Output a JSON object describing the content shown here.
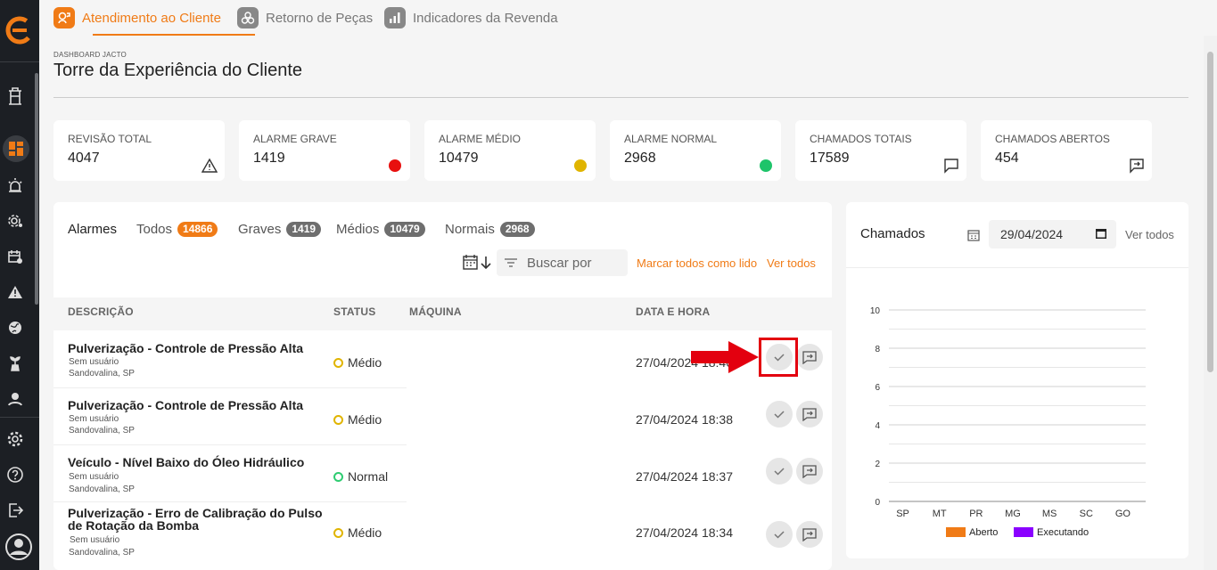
{
  "tabs": [
    {
      "label": "Atendimento ao Cliente",
      "active": true
    },
    {
      "label": "Retorno de Peças",
      "active": false
    },
    {
      "label": "Indicadores da Revenda",
      "active": false
    }
  ],
  "header": {
    "overline": "DASHBOARD JACTO",
    "title": "Torre da Experiência do Cliente"
  },
  "kpis": [
    {
      "label": "REVISÃO TOTAL",
      "value": "4047",
      "icon": "warning-icon"
    },
    {
      "label": "ALARME GRAVE",
      "value": "1419",
      "dot": "#e8100f"
    },
    {
      "label": "ALARME MÉDIO",
      "value": "10479",
      "dot": "#e0b400"
    },
    {
      "label": "ALARME NORMAL",
      "value": "2968",
      "dot": "#1ec46a"
    },
    {
      "label": "CHAMADOS TOTAIS",
      "value": "17589",
      "icon": "chat-icon"
    },
    {
      "label": "CHAMADOS ABERTOS",
      "value": "454",
      "icon": "chat-forward-icon"
    }
  ],
  "alarms": {
    "title": "Alarmes",
    "filters": [
      {
        "label": "Todos",
        "count": "14866"
      },
      {
        "label": "Graves",
        "count": "1419"
      },
      {
        "label": "Médios",
        "count": "10479"
      },
      {
        "label": "Normais",
        "count": "2968"
      }
    ],
    "search_placeholder": "Buscar por",
    "mark_all_read": "Marcar todos como lido",
    "see_all": "Ver todos",
    "columns": [
      "DESCRIÇÃO",
      "STATUS",
      "MÁQUINA",
      "DATA E HORA"
    ],
    "rows": [
      {
        "desc": "Pulverização - Controle de Pressão Alta",
        "user": "Sem usuário",
        "loc": "Sandovalina, SP",
        "status": "Médio",
        "datetime": "27/04/2024 18:40"
      },
      {
        "desc": "Pulverização - Controle de Pressão Alta",
        "user": "Sem usuário",
        "loc": "Sandovalina, SP",
        "status": "Médio",
        "datetime": "27/04/2024 18:38"
      },
      {
        "desc": "Veículo - Nível Baixo do Óleo Hidráulico",
        "user": "Sem usuário",
        "loc": "Sandovalina, SP",
        "status": "Normal",
        "datetime": "27/04/2024 18:37"
      },
      {
        "desc": "Pulverização - Erro de Calibração do Pulso",
        "desc2": "de Rotação da Bomba",
        "user": "Sem usuário",
        "loc": "Sandovalina, SP",
        "status": "Médio",
        "datetime": "27/04/2024 18:34"
      }
    ]
  },
  "chamados": {
    "title": "Chamados",
    "date": "29/04/2024",
    "see_all": "Ver todos"
  },
  "chart_data": {
    "type": "bar",
    "categories": [
      "SP",
      "MT",
      "PR",
      "MG",
      "MS",
      "SC",
      "GO"
    ],
    "series": [
      {
        "name": "Aberto",
        "color": "#f07b16",
        "values": [
          0,
          0,
          0,
          0,
          0,
          0,
          0
        ]
      },
      {
        "name": "Executando",
        "color": "#8a00ff",
        "values": [
          0,
          0,
          0,
          0,
          0,
          0,
          0
        ]
      }
    ],
    "ylim": [
      0,
      10
    ],
    "yticks": [
      0,
      2,
      4,
      6,
      8,
      10
    ],
    "grid": true,
    "legend": "bottom"
  },
  "colors": {
    "accent": "#f07b16",
    "sidebar": "#1c1f24"
  }
}
